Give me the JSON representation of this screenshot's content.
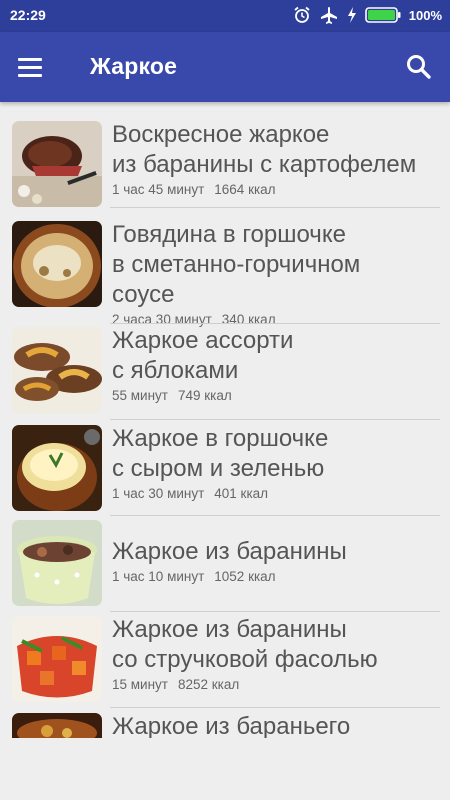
{
  "status": {
    "time": "22:29",
    "battery": "100%"
  },
  "app_bar": {
    "title": "Жаркое"
  },
  "recipes": [
    {
      "title": "Воскресное жаркое\nиз баранины с картофелем",
      "time": "1 час 45 минут",
      "calories": "1664 ккал"
    },
    {
      "title": "Говядина в горшочке\nв сметанно-горчичном\nсоусе",
      "time": "2 часа 30 минут",
      "calories": "340 ккал"
    },
    {
      "title": "Жаркое ассорти\nс яблоками",
      "time": "55 минут",
      "calories": "749 ккал"
    },
    {
      "title": "Жаркое в горшочке\nс сыром и зеленью",
      "time": "1 час 30 минут",
      "calories": "401 ккал"
    },
    {
      "title": "Жаркое из баранины",
      "time": "1 час 10 минут",
      "calories": "1052 ккал"
    },
    {
      "title": "Жаркое из баранины\nсо стручковой фасолью",
      "time": "15 минут",
      "calories": "8252 ккал"
    },
    {
      "title": "Жаркое из бараньего",
      "time": "",
      "calories": ""
    }
  ]
}
